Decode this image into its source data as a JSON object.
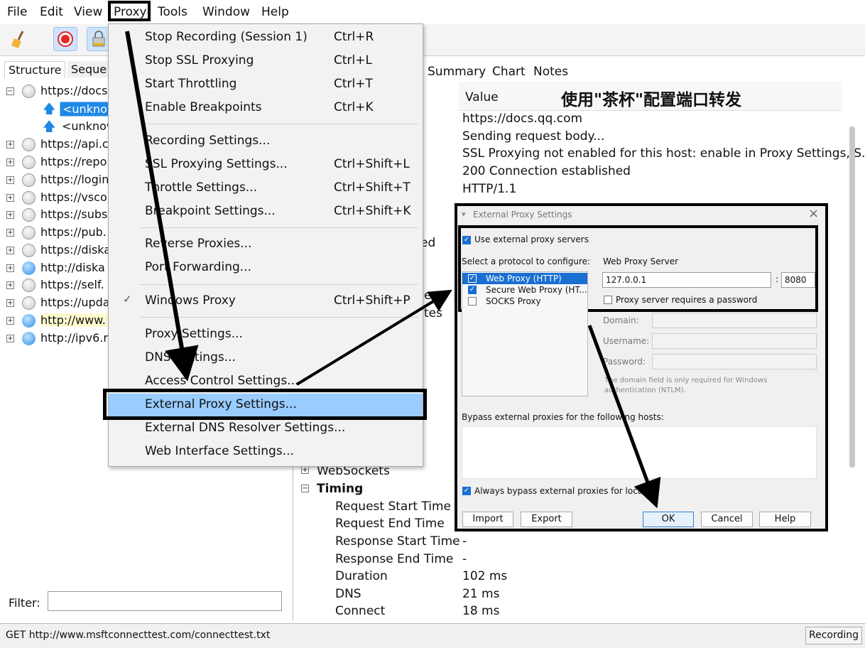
{
  "menubar": {
    "items": [
      "File",
      "Edit",
      "View",
      "Proxy",
      "Tools",
      "Window",
      "Help"
    ]
  },
  "left_pane": {
    "tabs": [
      "Structure",
      "Seque"
    ],
    "tree": [
      {
        "expander": "−",
        "icon": "lock",
        "label": "https://docs"
      },
      {
        "expander": "",
        "icon": "upload",
        "label": "<unknow",
        "selected": true
      },
      {
        "expander": "",
        "icon": "upload",
        "label": "<unknow"
      },
      {
        "expander": "+",
        "icon": "lock",
        "label": "https://api.c"
      },
      {
        "expander": "+",
        "icon": "lock",
        "label": "https://repo"
      },
      {
        "expander": "+",
        "icon": "lock",
        "label": "https://login"
      },
      {
        "expander": "+",
        "icon": "lock",
        "label": "https://vsco"
      },
      {
        "expander": "+",
        "icon": "lock",
        "label": "https://subs"
      },
      {
        "expander": "+",
        "icon": "lock",
        "label": "https://pub."
      },
      {
        "expander": "+",
        "icon": "lock",
        "label": "https://diska"
      },
      {
        "expander": "+",
        "icon": "globe",
        "label": "http://diska"
      },
      {
        "expander": "+",
        "icon": "lock",
        "label": "https://self."
      },
      {
        "expander": "+",
        "icon": "lock",
        "label": "https://upda"
      },
      {
        "expander": "+",
        "icon": "globe",
        "label": "http://www.",
        "highlight": true
      },
      {
        "expander": "+",
        "icon": "globe",
        "label": "http://ipv6.r"
      }
    ],
    "filter_label": "Filter:"
  },
  "right_pane": {
    "tabs": [
      "Summary",
      "Chart",
      "Notes"
    ],
    "value_header": "Value",
    "overlay_title": "使用\"茶杯\"配置端口转发",
    "top_values": [
      "https://docs.qq.com",
      "Sending request body...",
      "SSL Proxying not enabled for this host: enable in Proxy Settings, S...",
      "200 Connection established",
      "HTTP/1.1"
    ],
    "partial_fragments": [
      "ed",
      "es",
      "tes"
    ],
    "sections": [
      {
        "expander": "+",
        "label": "WebSockets"
      },
      {
        "expander": "−",
        "label": "Timing"
      }
    ],
    "timing_rows": [
      {
        "name": "Request Start Time",
        "value": ""
      },
      {
        "name": "Request End Time",
        "value": ""
      },
      {
        "name": "Response Start Time",
        "value": "-"
      },
      {
        "name": "Response End Time",
        "value": "-"
      },
      {
        "name": "Duration",
        "value": "102 ms"
      },
      {
        "name": "DNS",
        "value": "21 ms"
      },
      {
        "name": "Connect",
        "value": "18 ms"
      }
    ]
  },
  "proxy_menu": {
    "items": [
      {
        "label": "Stop Recording (Session 1)",
        "shortcut": "Ctrl+R"
      },
      {
        "label": "Stop SSL Proxying",
        "shortcut": "Ctrl+L"
      },
      {
        "label": "Start Throttling",
        "shortcut": "Ctrl+T"
      },
      {
        "label": "Enable Breakpoints",
        "shortcut": "Ctrl+K"
      },
      {
        "label": "Recording Settings...",
        "shortcut": ""
      },
      {
        "label": "SSL Proxying Settings...",
        "shortcut": "Ctrl+Shift+L"
      },
      {
        "label": "Throttle Settings...",
        "shortcut": "Ctrl+Shift+T"
      },
      {
        "label": "Breakpoint Settings...",
        "shortcut": "Ctrl+Shift+K"
      },
      {
        "label": "Reverse Proxies...",
        "shortcut": ""
      },
      {
        "label": "Port Forwarding...",
        "shortcut": ""
      },
      {
        "label": "Windows Proxy",
        "shortcut": "Ctrl+Shift+P",
        "checked": true
      },
      {
        "label": "Proxy Settings...",
        "shortcut": ""
      },
      {
        "label": "DNS Settings...",
        "shortcut": ""
      },
      {
        "label": "Access Control Settings...",
        "shortcut": ""
      },
      {
        "label": "External Proxy Settings...",
        "shortcut": "",
        "highlighted": true
      },
      {
        "label": "External DNS Resolver Settings...",
        "shortcut": ""
      },
      {
        "label": "Web Interface Settings...",
        "shortcut": ""
      }
    ]
  },
  "dialog": {
    "title": "External Proxy Settings",
    "use_external": "Use external proxy servers",
    "select_protocol": "Select a protocol to configure:",
    "protocols": [
      {
        "label": "Web Proxy (HTTP)",
        "checked": true,
        "selected": true
      },
      {
        "label": "Secure Web Proxy (HT...",
        "checked": true
      },
      {
        "label": "SOCKS Proxy",
        "checked": false
      }
    ],
    "server_label": "Web Proxy Server",
    "host": "127.0.0.1",
    "port_sep": ":",
    "port": "8080",
    "requires_password": "Proxy server requires a password",
    "domain_label": "Domain:",
    "username_label": "Username:",
    "password_label": "Password:",
    "domain_note_1": "The domain field is only required for Windows",
    "domain_note_2": "authentication (NTLM).",
    "bypass_label": "Bypass external proxies for the following hosts:",
    "always_bypass": "Always bypass external proxies for localho",
    "buttons": {
      "import": "Import",
      "export": "Export",
      "ok": "OK",
      "cancel": "Cancel",
      "help": "Help"
    },
    "close": "×"
  },
  "statusbar": {
    "url": "GET http://www.msftconnecttest.com/connecttest.txt",
    "recording": "Recording"
  },
  "colors": {
    "menu_highlight": "#99ccff",
    "selection": "#1e88e5",
    "toolbar_active": "#cfe4fb",
    "record_red": "#e32626"
  }
}
